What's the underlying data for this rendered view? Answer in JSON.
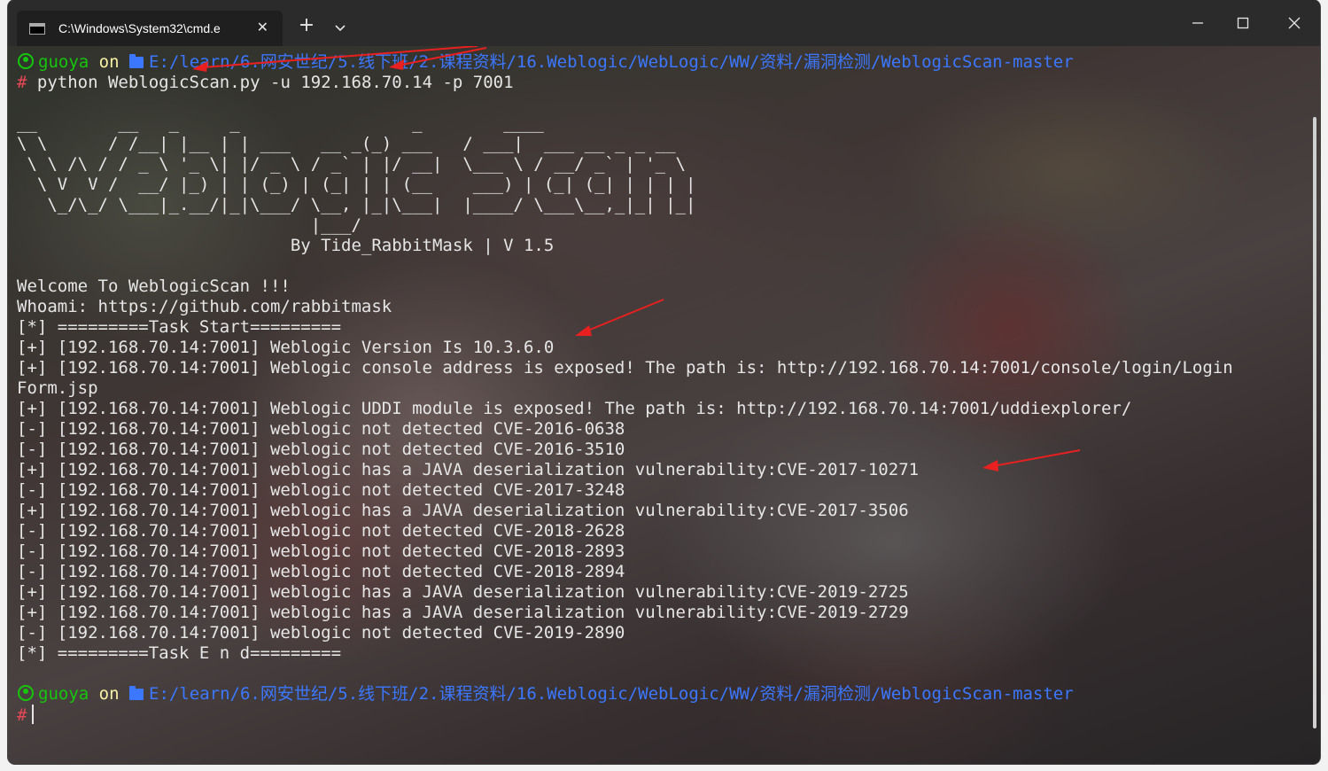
{
  "window": {
    "tab_title": "C:\\Windows\\System32\\cmd.e",
    "close_tab_glyph": "✕",
    "new_tab_glyph": "+"
  },
  "terminal": {
    "prompt1": {
      "user": "guoya",
      "on": "on",
      "path": "E:/learn/6.网安世纪/5.线下班/2.课程资料/16.Weblogic/WebLogic/WW/资料/漏洞检测/WeblogicScan-master",
      "hash": "#",
      "command": "python WeblogicScan.py -u 192.168.70.14 -p 7001"
    },
    "ascii_art": [
      "__        __   _     _                 _        ____                  ",
      "\\ \\      / /__| |__ | | ___   __ _(_) ___   / ___|  ___ __ _ _ __  ",
      " \\ \\ /\\ / / _ \\ '_ \\| |/ _ \\ / _` | |/ __|  \\___ \\ / __/ _` | '_ \\ ",
      "  \\ V  V /  __/ |_) | | (_) | (_| | | (__    ___) | (_| (_| | | | |",
      "   \\_/\\_/ \\___|_.__/|_|\\___/ \\__, |_|\\___|  |____/ \\___\\__,_|_| |_|",
      "                             |___/ ",
      "                           By Tide_RabbitMask | V 1.5"
    ],
    "output_lines": [
      "",
      "Welcome To WeblogicScan !!!",
      "Whoami: https://github.com/rabbitmask",
      "[*] =========Task Start=========",
      "[+] [192.168.70.14:7001] Weblogic Version Is 10.3.6.0",
      "[+] [192.168.70.14:7001] Weblogic console address is exposed! The path is: http://192.168.70.14:7001/console/login/Login",
      "Form.jsp",
      "[+] [192.168.70.14:7001] Weblogic UDDI module is exposed! The path is: http://192.168.70.14:7001/uddiexplorer/",
      "[-] [192.168.70.14:7001] weblogic not detected CVE-2016-0638",
      "[-] [192.168.70.14:7001] weblogic not detected CVE-2016-3510",
      "[+] [192.168.70.14:7001] weblogic has a JAVA deserialization vulnerability:CVE-2017-10271",
      "[-] [192.168.70.14:7001] weblogic not detected CVE-2017-3248",
      "[+] [192.168.70.14:7001] weblogic has a JAVA deserialization vulnerability:CVE-2017-3506",
      "[-] [192.168.70.14:7001] weblogic not detected CVE-2018-2628",
      "[-] [192.168.70.14:7001] weblogic not detected CVE-2018-2893",
      "[-] [192.168.70.14:7001] weblogic not detected CVE-2018-2894",
      "[+] [192.168.70.14:7001] weblogic has a JAVA deserialization vulnerability:CVE-2019-2725",
      "[+] [192.168.70.14:7001] weblogic has a JAVA deserialization vulnerability:CVE-2019-2729",
      "[-] [192.168.70.14:7001] weblogic not detected CVE-2019-2890",
      "[*] =========Task E n d=========",
      ""
    ],
    "prompt2": {
      "user": "guoya",
      "on": "on",
      "path": "E:/learn/6.网安世纪/5.线下班/2.课程资料/16.Weblogic/WebLogic/WW/资料/漏洞检测/WeblogicScan-master",
      "hash": "#"
    }
  },
  "colors": {
    "user": "#16c60c",
    "path": "#3b78ff",
    "hash": "#e74856",
    "arrow": "#e8201f"
  }
}
